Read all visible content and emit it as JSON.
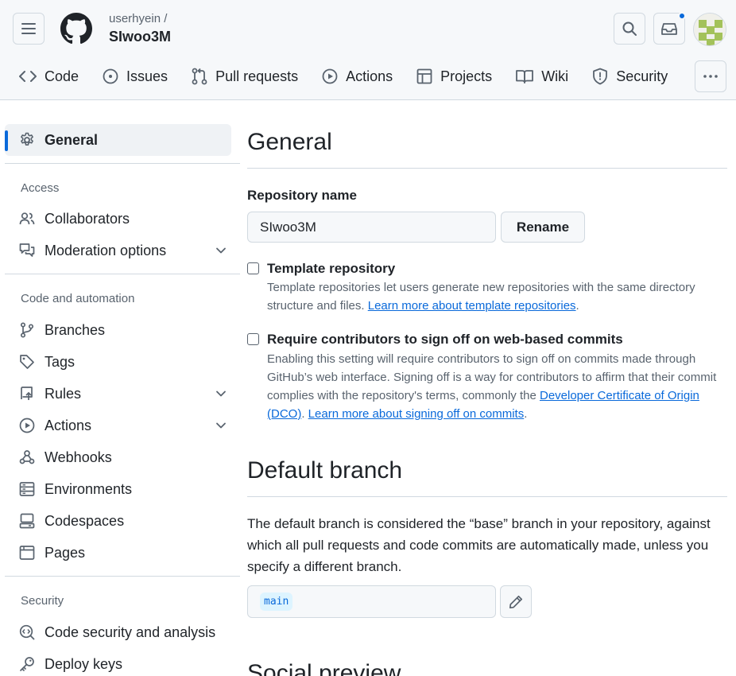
{
  "header": {
    "owner": "userhyein /",
    "repo": "SIwoo3M"
  },
  "tabs": [
    {
      "label": "Code",
      "icon": "code-icon"
    },
    {
      "label": "Issues",
      "icon": "issue-opened-icon"
    },
    {
      "label": "Pull requests",
      "icon": "git-pull-request-icon"
    },
    {
      "label": "Actions",
      "icon": "play-icon"
    },
    {
      "label": "Projects",
      "icon": "table-icon"
    },
    {
      "label": "Wiki",
      "icon": "book-icon"
    },
    {
      "label": "Security",
      "icon": "shield-icon"
    }
  ],
  "sidebar": {
    "general": "General",
    "groups": {
      "access": "Access",
      "code_automation": "Code and automation",
      "security": "Security"
    },
    "items": {
      "collaborators": "Collaborators",
      "moderation": "Moderation options",
      "branches": "Branches",
      "tags": "Tags",
      "rules": "Rules",
      "actions": "Actions",
      "webhooks": "Webhooks",
      "environments": "Environments",
      "codespaces": "Codespaces",
      "pages": "Pages",
      "code_security": "Code security and analysis",
      "deploy_keys": "Deploy keys"
    }
  },
  "main": {
    "general_title": "General",
    "repo_name_label": "Repository name",
    "repo_name_value": "SIwoo3M",
    "rename_button": "Rename",
    "template": {
      "title": "Template repository",
      "desc": "Template repositories let users generate new repositories with the same directory structure and files.",
      "link": "Learn more about template repositories",
      "end": ".",
      "checked": false
    },
    "signoff": {
      "title": "Require contributors to sign off on web-based commits",
      "desc": "Enabling this setting will require contributors to sign off on commits made through GitHub’s web interface. Signing off is a way for contributors to affirm that their commit complies with the repository's terms, commonly the",
      "link1": "Developer Certificate of Origin (DCO)",
      "sep": ".",
      "link2": "Learn more about signing off on commits",
      "end": ".",
      "checked": false
    },
    "default_branch_title": "Default branch",
    "default_branch_desc": "The default branch is considered the “base” branch in your repository, against which all pull requests and code commits are automatically made, unless you specify a different branch.",
    "branch_name": "main",
    "social_preview_title": "Social preview"
  },
  "colors": {
    "accent": "#0969da",
    "notification": "#0969da",
    "border": "#d1d9e0",
    "muted_text": "#59636e"
  }
}
